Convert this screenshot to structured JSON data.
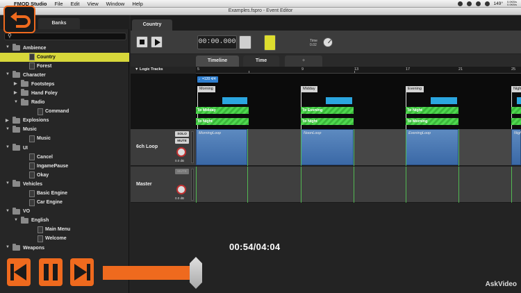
{
  "menubar": {
    "app_name": "FMOD Studio",
    "menus": [
      "File",
      "Edit",
      "View",
      "Window",
      "Help"
    ],
    "battery": "149°",
    "net_up": "0.0KB/s",
    "net_down": "0.0KB/s"
  },
  "window": {
    "title": "Examples.fspro - Event Editor"
  },
  "browser": {
    "tab_banks": "Banks",
    "tree": [
      {
        "type": "folder",
        "depth": 0,
        "label": "Ambience",
        "expanded": true
      },
      {
        "type": "event",
        "depth": 1,
        "label": "Country",
        "selected": true
      },
      {
        "type": "event",
        "depth": 1,
        "label": "Forest"
      },
      {
        "type": "folder",
        "depth": 0,
        "label": "Character",
        "expanded": true
      },
      {
        "type": "folder",
        "depth": 1,
        "label": "Footsteps",
        "expanded": false
      },
      {
        "type": "folder",
        "depth": 1,
        "label": "Hand Foley",
        "expanded": false
      },
      {
        "type": "folder",
        "depth": 1,
        "label": "Radio",
        "expanded": true
      },
      {
        "type": "event",
        "depth": 2,
        "label": "Command"
      },
      {
        "type": "folder",
        "depth": 0,
        "label": "Explosions",
        "expanded": false
      },
      {
        "type": "folder",
        "depth": 0,
        "label": "Music",
        "expanded": true
      },
      {
        "type": "event",
        "depth": 1,
        "label": "Music"
      },
      {
        "type": "folder",
        "depth": 0,
        "label": "UI",
        "expanded": true
      },
      {
        "type": "event",
        "depth": 1,
        "label": "Cancel"
      },
      {
        "type": "event",
        "depth": 1,
        "label": "IngamePause"
      },
      {
        "type": "event",
        "depth": 1,
        "label": "Okay"
      },
      {
        "type": "folder",
        "depth": 0,
        "label": "Vehicles",
        "expanded": true
      },
      {
        "type": "event",
        "depth": 1,
        "label": "Basic Engine"
      },
      {
        "type": "event",
        "depth": 1,
        "label": "Car Engine"
      },
      {
        "type": "folder",
        "depth": 0,
        "label": "VO",
        "expanded": true
      },
      {
        "type": "folder",
        "depth": 1,
        "label": "English",
        "expanded": true
      },
      {
        "type": "event",
        "depth": 2,
        "label": "Main Menu"
      },
      {
        "type": "event",
        "depth": 2,
        "label": "Welcome"
      },
      {
        "type": "folder",
        "depth": 0,
        "label": "Weapons",
        "expanded": true
      }
    ]
  },
  "editor": {
    "event_tab": "Country",
    "transport_time": "00:00.000",
    "time_label": "Time",
    "time_value": "0.02",
    "tab_timeline": "Timeline",
    "tab_time": "Time",
    "tab_add": "+",
    "logic_tracks": "Logic Tracks",
    "ruler": [
      "5",
      "9",
      "13",
      "17",
      "21",
      "25"
    ],
    "tempo": "♩=120 4/4",
    "markers": [
      "Morning",
      "Midday",
      "Evening",
      "Night"
    ],
    "transitions": [
      "To Midday",
      "To Night",
      "To Evening",
      "To Night",
      "To Night",
      "To Morning"
    ],
    "tracks": [
      {
        "name": "6ch Loop",
        "solo": "SOLO",
        "mute": "MUTE",
        "db": "0.0 dB",
        "clips": [
          "MorningLoop",
          "NoonLoop",
          "EveningLoop",
          "Nigh"
        ]
      },
      {
        "name": "Master",
        "mute": "MUTE",
        "db": "0.0 dB"
      }
    ]
  },
  "player": {
    "timecode": "00:54/04:04",
    "progress": 0.2213,
    "brand": "AskVideo",
    "accent": "#ef6a1e"
  },
  "colors": {
    "selection": "#d7d73a",
    "tempo": "#2f7fd0",
    "region": "#2ba6e0",
    "transition": "#4fd84f",
    "clip": "#4a78b4"
  }
}
